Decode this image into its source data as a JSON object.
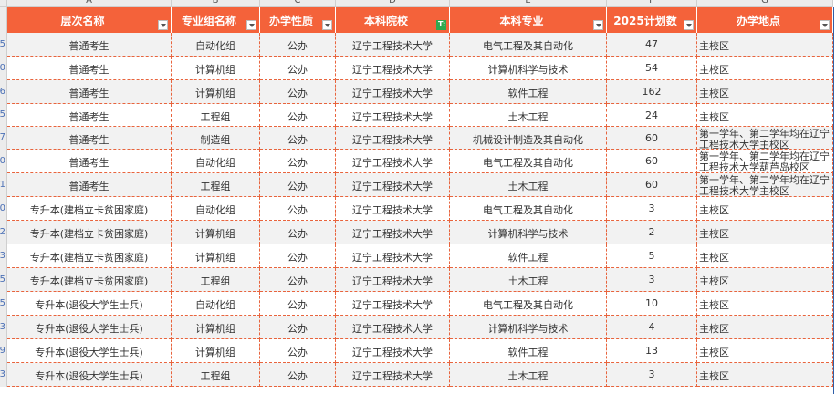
{
  "column_letters": [
    "A",
    "B",
    "C",
    "D",
    "E",
    "F",
    "G"
  ],
  "row_numbers": [
    "5",
    "0",
    "6",
    "5",
    "7",
    "0",
    "1",
    "0",
    "2",
    "3",
    "5",
    "5",
    "3",
    "9",
    "3"
  ],
  "headers": [
    "层次名称",
    "专业组名称",
    "办学性质",
    "本科院校",
    "本科专业",
    "2025计划数",
    "办学地点"
  ],
  "filter_active_index": 3,
  "rows": [
    [
      "普通考生",
      "自动化组",
      "公办",
      "辽宁工程技术大学",
      "电气工程及其自动化",
      "47",
      "主校区"
    ],
    [
      "普通考生",
      "计算机组",
      "公办",
      "辽宁工程技术大学",
      "计算机科学与技术",
      "54",
      "主校区"
    ],
    [
      "普通考生",
      "计算机组",
      "公办",
      "辽宁工程技术大学",
      "软件工程",
      "162",
      "主校区"
    ],
    [
      "普通考生",
      "工程组",
      "公办",
      "辽宁工程技术大学",
      "土木工程",
      "24",
      "主校区"
    ],
    [
      "普通考生",
      "制造组",
      "公办",
      "辽宁工程技术大学",
      "机械设计制造及其自动化",
      "60",
      "第一学年、第二学年均在辽宁工程技术大学主校区"
    ],
    [
      "普通考生",
      "自动化组",
      "公办",
      "辽宁工程技术大学",
      "电气工程及其自动化",
      "60",
      "第一学年、第二学年均在辽宁工程技术大学葫芦岛校区"
    ],
    [
      "普通考生",
      "工程组",
      "公办",
      "辽宁工程技术大学",
      "土木工程",
      "60",
      "第一学年、第二学年均在辽宁工程技术大学主校区"
    ],
    [
      "专升本(建档立卡贫困家庭)",
      "自动化组",
      "公办",
      "辽宁工程技术大学",
      "电气工程及其自动化",
      "3",
      "主校区"
    ],
    [
      "专升本(建档立卡贫困家庭)",
      "计算机组",
      "公办",
      "辽宁工程技术大学",
      "计算机科学与技术",
      "2",
      "主校区"
    ],
    [
      "专升本(建档立卡贫困家庭)",
      "计算机组",
      "公办",
      "辽宁工程技术大学",
      "软件工程",
      "5",
      "主校区"
    ],
    [
      "专升本(建档立卡贫困家庭)",
      "工程组",
      "公办",
      "辽宁工程技术大学",
      "土木工程",
      "3",
      "主校区"
    ],
    [
      "专升本(退役大学生士兵)",
      "自动化组",
      "公办",
      "辽宁工程技术大学",
      "电气工程及其自动化",
      "10",
      "主校区"
    ],
    [
      "专升本(退役大学生士兵)",
      "计算机组",
      "公办",
      "辽宁工程技术大学",
      "计算机科学与技术",
      "4",
      "主校区"
    ],
    [
      "专升本(退役大学生士兵)",
      "计算机组",
      "公办",
      "辽宁工程技术大学",
      "软件工程",
      "13",
      "主校区"
    ],
    [
      "专升本(退役大学生士兵)",
      "工程组",
      "公办",
      "辽宁工程技术大学",
      "土木工程",
      "3",
      "主校区"
    ]
  ],
  "colors": {
    "header_bg": "#f4623a",
    "grid_dash": "#e8643d",
    "row_alt": "#f2f2f2",
    "filter_active": "#2fa84f"
  }
}
